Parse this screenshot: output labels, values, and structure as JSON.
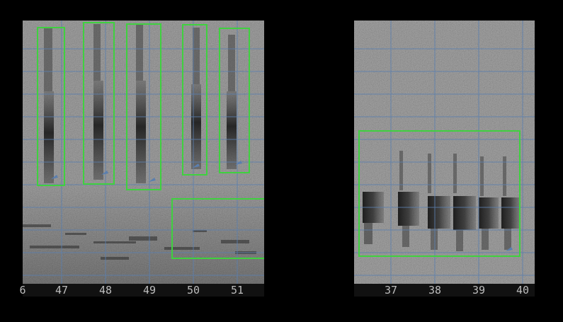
{
  "left_panel": {
    "axis_ticks": [
      "6",
      "47",
      "48",
      "49",
      "50",
      "51"
    ]
  },
  "right_panel": {
    "axis_ticks": [
      "37",
      "38",
      "39",
      "40"
    ]
  },
  "colors": {
    "background": "#000000",
    "spectrogram": "#7f7f7f",
    "grid": "#5b7fae",
    "detection_box": "#3fd13f",
    "tick_text": "#bdbdbd"
  }
}
